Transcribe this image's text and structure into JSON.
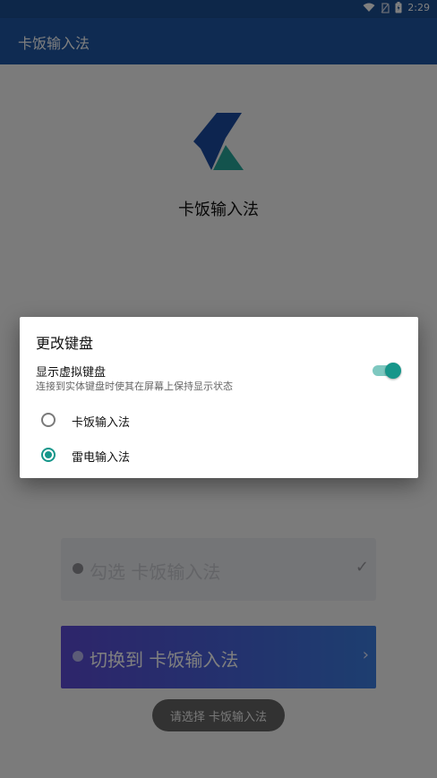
{
  "status_bar": {
    "time": "2:29"
  },
  "app_bar": {
    "title": "卡饭输入法"
  },
  "main": {
    "app_name": "卡饭输入法",
    "buttons": [
      {
        "label": "勾选 卡饭输入法",
        "end_icon": "check-icon"
      },
      {
        "label": "切换到 卡饭输入法",
        "end_icon": "chevron-right-icon"
      }
    ],
    "toast": "请选择 卡饭输入法"
  },
  "dialog": {
    "title": "更改键盘",
    "toggle_label": "显示虚拟键盘",
    "toggle_sub": "连接到实体键盘时使其在屏幕上保持显示状态",
    "toggle_on": true,
    "options": [
      {
        "label": "卡饭输入法",
        "selected": false
      },
      {
        "label": "雷电输入法",
        "selected": true
      }
    ]
  },
  "colors": {
    "appbar": "#1f57a4",
    "statusbar": "#1b4f93",
    "accent": "#16968a",
    "logo_blue": "#1a4aa0",
    "logo_teal": "#27a79a"
  }
}
